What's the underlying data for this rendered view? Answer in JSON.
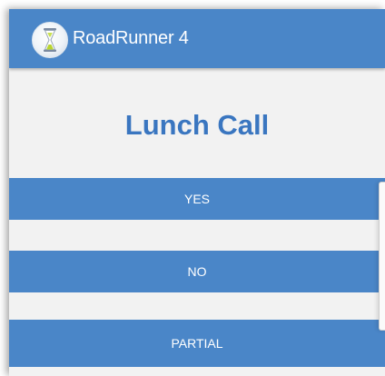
{
  "app": {
    "title": "RoadRunner 4",
    "logo_icon": "hourglass-icon"
  },
  "main": {
    "heading": "Lunch Call"
  },
  "choices": [
    {
      "label": "YES"
    },
    {
      "label": "NO"
    },
    {
      "label": "PARTIAL"
    }
  ],
  "colors": {
    "accent": "#4a86c8",
    "heading": "#3a76c0",
    "background": "#f2f2f2"
  }
}
